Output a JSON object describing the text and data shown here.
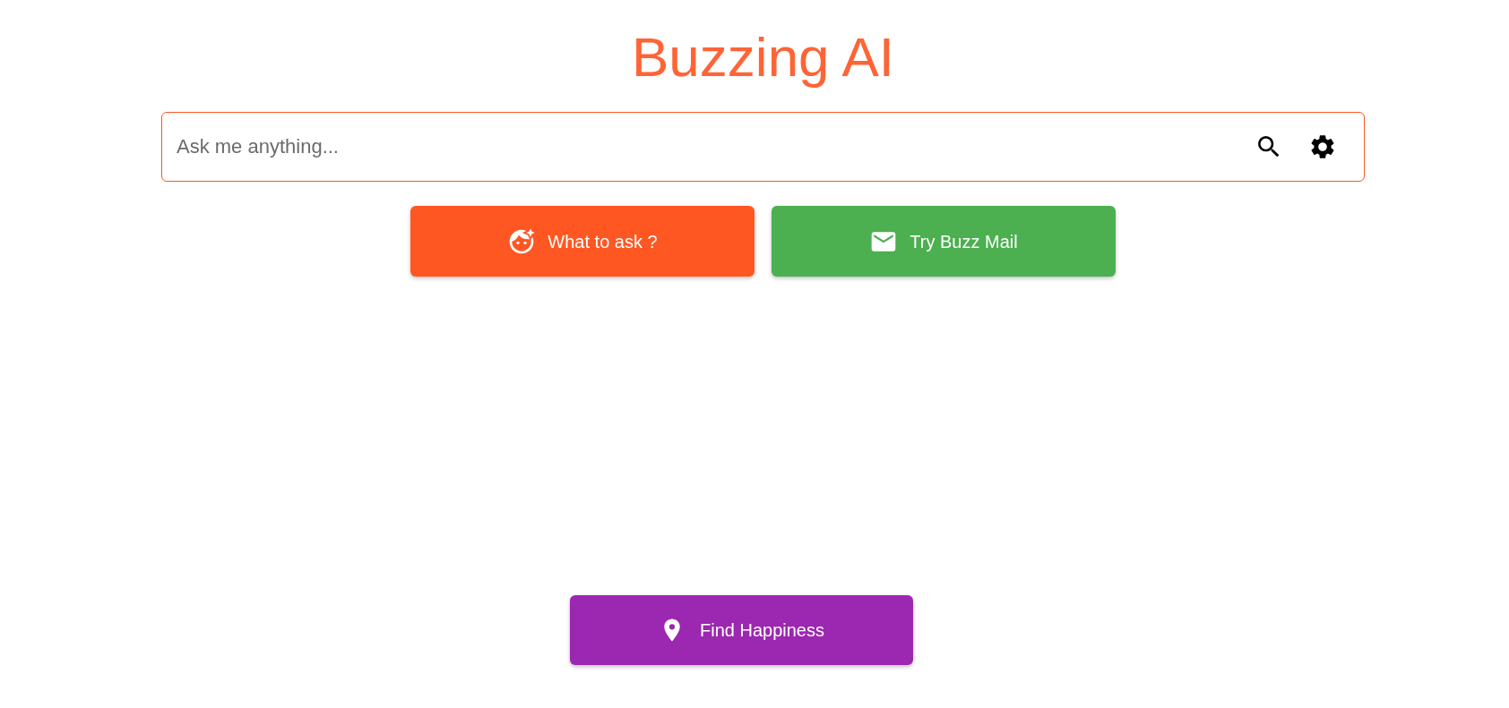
{
  "title": "Buzzing AI",
  "search": {
    "placeholder": "Ask me anything..."
  },
  "actions": [
    {
      "label": "What to ask ?",
      "kind": "suggest",
      "color": "#ff5722"
    },
    {
      "label": "Try Buzz Mail",
      "kind": "mail",
      "color": "#4caf50"
    }
  ],
  "footer_action": {
    "label": "Find Happiness",
    "kind": "location"
  }
}
